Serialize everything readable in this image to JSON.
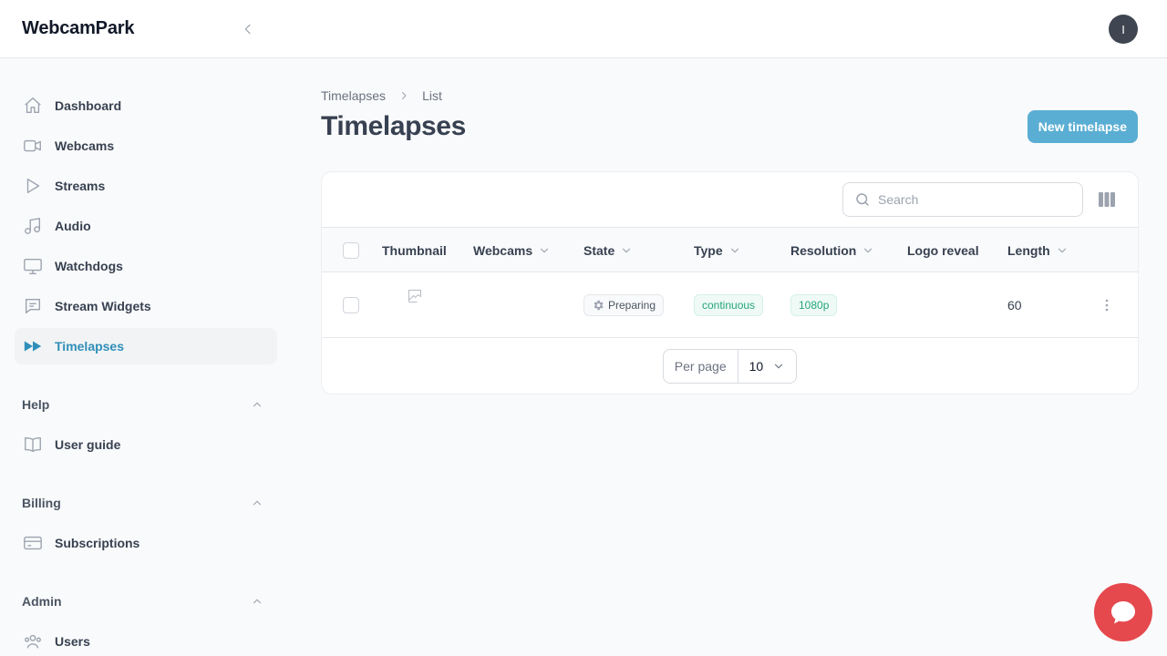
{
  "brand": "WebcamPark",
  "user": {
    "avatar_initial": "I"
  },
  "sidebar": {
    "items": [
      {
        "label": "Dashboard",
        "icon": "home-icon"
      },
      {
        "label": "Webcams",
        "icon": "video-camera-icon"
      },
      {
        "label": "Streams",
        "icon": "play-icon"
      },
      {
        "label": "Audio",
        "icon": "music-note-icon"
      },
      {
        "label": "Watchdogs",
        "icon": "monitor-icon"
      },
      {
        "label": "Stream Widgets",
        "icon": "chat-bubble-icon"
      },
      {
        "label": "Timelapses",
        "icon": "fast-forward-icon",
        "active": true
      }
    ],
    "groups": [
      {
        "title": "Help",
        "items": [
          {
            "label": "User guide",
            "icon": "book-icon"
          }
        ]
      },
      {
        "title": "Billing",
        "items": [
          {
            "label": "Subscriptions",
            "icon": "credit-card-icon"
          }
        ]
      },
      {
        "title": "Admin",
        "items": [
          {
            "label": "Users",
            "icon": "users-icon"
          }
        ]
      }
    ]
  },
  "breadcrumb": [
    "Timelapses",
    "List"
  ],
  "page": {
    "title": "Timelapses",
    "primary_action": "New timelapse"
  },
  "search": {
    "placeholder": "Search"
  },
  "table": {
    "columns": [
      "Thumbnail",
      "Webcams",
      "State",
      "Type",
      "Resolution",
      "Logo reveal",
      "Length"
    ],
    "sortable": [
      "Webcams",
      "State",
      "Type",
      "Resolution",
      "Length"
    ],
    "rows": [
      {
        "thumbnail": "broken-image",
        "webcams": "",
        "state": "Preparing",
        "type": "continuous",
        "resolution": "1080p",
        "logo_reveal": "",
        "length": "60"
      }
    ]
  },
  "pagination": {
    "per_page_label": "Per page",
    "per_page_value": "10"
  },
  "colors": {
    "accent": "#5aaed3",
    "active_text": "#2f8fb9",
    "chat": "#e5484d",
    "badge_green": "#24a67a"
  }
}
